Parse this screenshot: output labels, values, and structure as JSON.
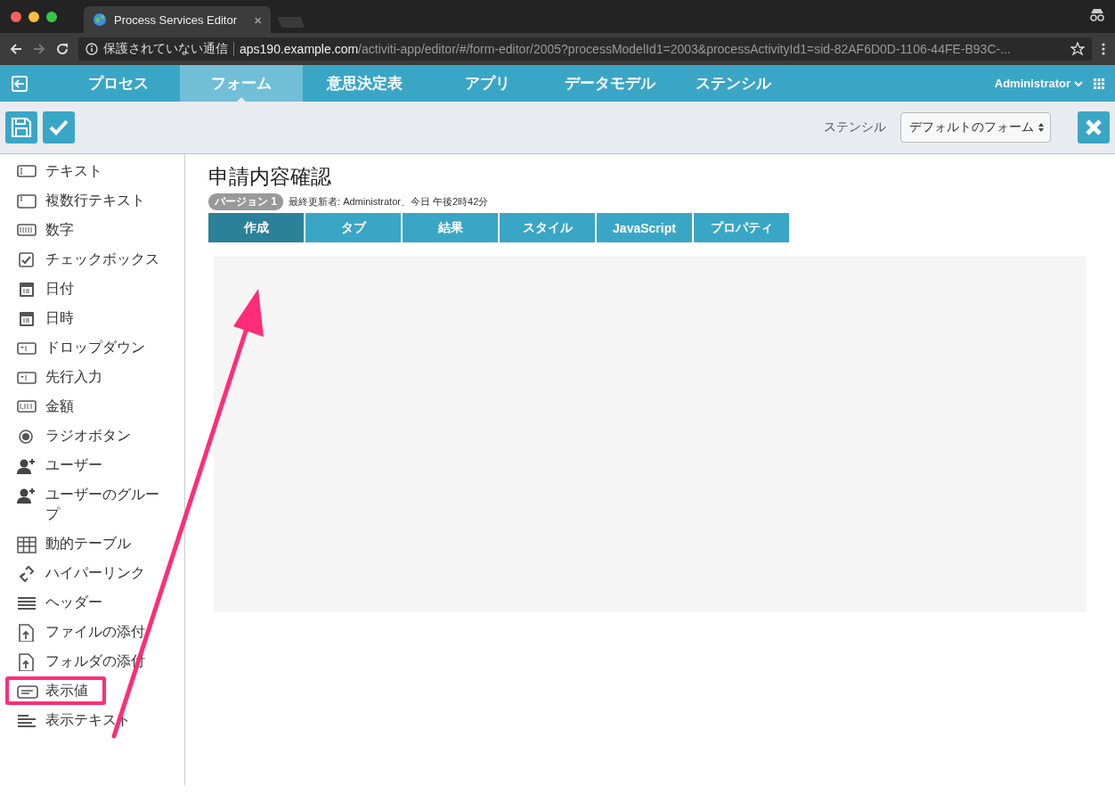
{
  "browser": {
    "tab_title": "Process Services Editor",
    "close": "×",
    "security_label": "保護されていない通信",
    "url_host": "aps190.example.com",
    "url_path": "/activiti-app/editor/#/form-editor/2005?processModelId1=2003&processActivityId1=sid-82AF6D0D-1106-44FE-B93C-..."
  },
  "nav": {
    "items": [
      {
        "label": "プロセス",
        "selected": false
      },
      {
        "label": "フォーム",
        "selected": true
      },
      {
        "label": "意思決定表",
        "selected": false
      },
      {
        "label": "アプリ",
        "selected": false
      },
      {
        "label": "データモデル",
        "selected": false
      },
      {
        "label": "ステンシル",
        "selected": false
      }
    ],
    "user": "Administrator"
  },
  "toolbar": {
    "stencil_label": "ステンシル",
    "stencil_value": "デフォルトのフォーム"
  },
  "palette": [
    {
      "label": "テキスト",
      "kind": "text",
      "highlighted": false
    },
    {
      "label": "複数行テキスト",
      "kind": "multiline",
      "highlighted": false
    },
    {
      "label": "数字",
      "kind": "number",
      "highlighted": false
    },
    {
      "label": "チェックボックス",
      "kind": "checkbox",
      "highlighted": false
    },
    {
      "label": "日付",
      "kind": "date",
      "highlighted": false
    },
    {
      "label": "日時",
      "kind": "date",
      "highlighted": false
    },
    {
      "label": "ドロップダウン",
      "kind": "dropdown",
      "highlighted": false
    },
    {
      "label": "先行入力",
      "kind": "dropdown",
      "highlighted": false
    },
    {
      "label": "金額",
      "kind": "amount",
      "highlighted": false
    },
    {
      "label": "ラジオボタン",
      "kind": "radio",
      "highlighted": false
    },
    {
      "label": "ユーザー",
      "kind": "person",
      "highlighted": false
    },
    {
      "label": "ユーザーのグループ",
      "kind": "person",
      "highlighted": false
    },
    {
      "label": "動的テーブル",
      "kind": "table",
      "highlighted": false
    },
    {
      "label": "ハイパーリンク",
      "kind": "link",
      "highlighted": false
    },
    {
      "label": "ヘッダー",
      "kind": "header",
      "highlighted": false
    },
    {
      "label": "ファイルの添付",
      "kind": "upload",
      "highlighted": false
    },
    {
      "label": "フォルダの添付",
      "kind": "upload",
      "highlighted": false
    },
    {
      "label": "表示値",
      "kind": "display",
      "highlighted": true
    },
    {
      "label": "表示テキスト",
      "kind": "paragraph",
      "highlighted": false
    }
  ],
  "form": {
    "title": "申請内容確認",
    "version_badge": "バージョン 1",
    "modified": "最終更新者: Administrator、今日 午後2時42分",
    "tabs": [
      {
        "label": "作成",
        "selected": true
      },
      {
        "label": "タブ",
        "selected": false
      },
      {
        "label": "結果",
        "selected": false
      },
      {
        "label": "スタイル",
        "selected": false
      },
      {
        "label": "JavaScript",
        "selected": false
      },
      {
        "label": "プロパティ",
        "selected": false
      }
    ]
  }
}
